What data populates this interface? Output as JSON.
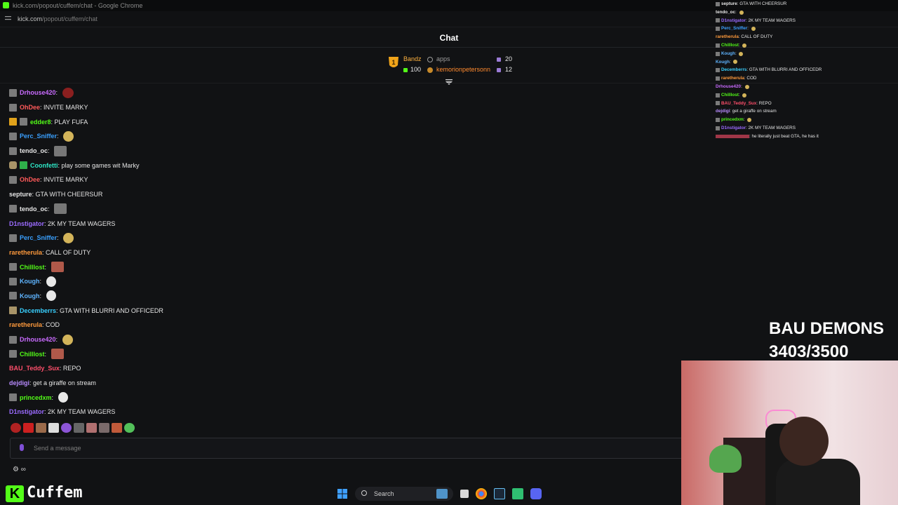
{
  "browser": {
    "title": "kick.com/popout/cuffem/chat - Google Chrome",
    "url_domain": "kick.com",
    "url_path": "/popout/cuffem/chat"
  },
  "chat": {
    "title": "Chat",
    "leaderboard": [
      {
        "rank": "1",
        "name": "Bandz",
        "amount": "100"
      },
      {
        "name": "apps"
      },
      {
        "name": "kemorionpetersonn"
      }
    ],
    "leaderboard_counts": [
      "20",
      "12"
    ],
    "messages": [
      {
        "user": "Drhouse420",
        "color": "#c96bff",
        "text": "",
        "emote": "red",
        "badge": "gray"
      },
      {
        "user": "OhDee",
        "color": "#ff5a5a",
        "text": "INVITE MARKY",
        "badge": "gray"
      },
      {
        "user": "edder8",
        "color": "#53fc18",
        "text": "PLAY FUFA",
        "badge": "crown"
      },
      {
        "user": "Perc_Sniffer",
        "color": "#3aa0ff",
        "text": "",
        "emote": "yellow",
        "badge": "gray"
      },
      {
        "user": "tendo_oc",
        "color": "#e6e6e6",
        "text": "",
        "emote": "gray",
        "badge": "gray"
      },
      {
        "user": "Coonfetti",
        "color": "#2ee6c6",
        "text": "play some games wit Marky",
        "badge": "sub"
      },
      {
        "user": "OhDee",
        "color": "#ff5a5a",
        "text": "INVITE MARKY",
        "badge": "gray"
      },
      {
        "user": "septure",
        "color": "#e6e6e6",
        "text": "GTA WITH CHEERSUR",
        "badge": ""
      },
      {
        "user": "tendo_oc",
        "color": "#e6e6e6",
        "text": "",
        "emote": "gray",
        "badge": "gray"
      },
      {
        "user": "D1nstigator",
        "color": "#9b6bff",
        "text": "2K MY TEAM WAGERS",
        "badge": ""
      },
      {
        "user": "Perc_Sniffer",
        "color": "#3aa0ff",
        "text": "",
        "emote": "yellow",
        "badge": "gray"
      },
      {
        "user": "raretherula",
        "color": "#ff9a3c",
        "text": "CALL OF DUTY",
        "badge": ""
      },
      {
        "user": "Chilllost",
        "color": "#53fc18",
        "text": "",
        "emote": "face",
        "badge": "gray"
      },
      {
        "user": "Kough",
        "color": "#5fb4ff",
        "text": "",
        "emote": "white",
        "badge": "gray"
      },
      {
        "user": "Kough",
        "color": "#5fb4ff",
        "text": "",
        "emote": "white",
        "badge": "gray"
      },
      {
        "user": "Decemberrs",
        "color": "#39d0ff",
        "text": "GTA WITH BLURRI AND OFFICEDR",
        "badge": "tan"
      },
      {
        "user": "raretherula",
        "color": "#ff9a3c",
        "text": "COD",
        "badge": ""
      },
      {
        "user": "Drhouse420",
        "color": "#c96bff",
        "text": "",
        "emote": "yellow",
        "badge": "gray"
      },
      {
        "user": "Chilllost",
        "color": "#53fc18",
        "text": "",
        "emote": "face",
        "badge": "gray"
      },
      {
        "user": "BAU_Teddy_Sux",
        "color": "#ff4f6b",
        "text": "REPO",
        "badge": ""
      },
      {
        "user": "dejdigi",
        "color": "#b98bff",
        "text": "get a giraffe on stream",
        "badge": ""
      },
      {
        "user": "princedxm",
        "color": "#53fc18",
        "text": "",
        "emote": "white",
        "badge": "gray"
      },
      {
        "user": "D1nstigator",
        "color": "#9b6bff",
        "text": "2K MY TEAM WAGERS",
        "badge": ""
      }
    ],
    "input_placeholder": "Send a message",
    "bottom_icons": "∞"
  },
  "overlay_chat": [
    {
      "user": "septure",
      "color": "#e6e6e6",
      "text": "GTA WITH CHEERSUR"
    },
    {
      "user": "tendo_oc",
      "color": "#e6e6e6",
      "text": ""
    },
    {
      "user": "D1nstigator",
      "color": "#9b6bff",
      "text": "2K MY TEAM WAGERS"
    },
    {
      "user": "Perc_Sniffer",
      "color": "#3aa0ff",
      "text": ""
    },
    {
      "user": "raretherula",
      "color": "#ff9a3c",
      "text": "CALL OF DUTY"
    },
    {
      "user": "Chilllost",
      "color": "#53fc18",
      "text": ""
    },
    {
      "user": "Kough",
      "color": "#5fb4ff",
      "text": ""
    },
    {
      "user": "Kough",
      "color": "#5fb4ff",
      "text": ""
    },
    {
      "user": "Decemberrs",
      "color": "#39d0ff",
      "text": "GTA WITH BLURRI AND OFFICEDR"
    },
    {
      "user": "raretherula",
      "color": "#ff9a3c",
      "text": "COD"
    },
    {
      "user": "Drhouse420",
      "color": "#c96bff",
      "text": ""
    },
    {
      "user": "Chilllost",
      "color": "#53fc18",
      "text": ""
    },
    {
      "user": "BAU_Teddy_Sux",
      "color": "#ff4f6b",
      "text": "REPO"
    },
    {
      "user": "dejdigi",
      "color": "#b98bff",
      "text": "get a giraffe on stream"
    },
    {
      "user": "princedxm",
      "color": "#53fc18",
      "text": ""
    },
    {
      "user": "D1nstigator",
      "color": "#9b6bff",
      "text": "2K MY TEAM WAGERS"
    },
    {
      "user": "",
      "color": "#ff4f6b",
      "text": "he literally just beat GTA, he has it"
    }
  ],
  "counter": {
    "line1": "BAU DEMONS",
    "line2": "3403/3500"
  },
  "streamer": {
    "logo_letter": "K",
    "name": "Cuffem"
  },
  "taskbar": {
    "search_label": "Search"
  }
}
